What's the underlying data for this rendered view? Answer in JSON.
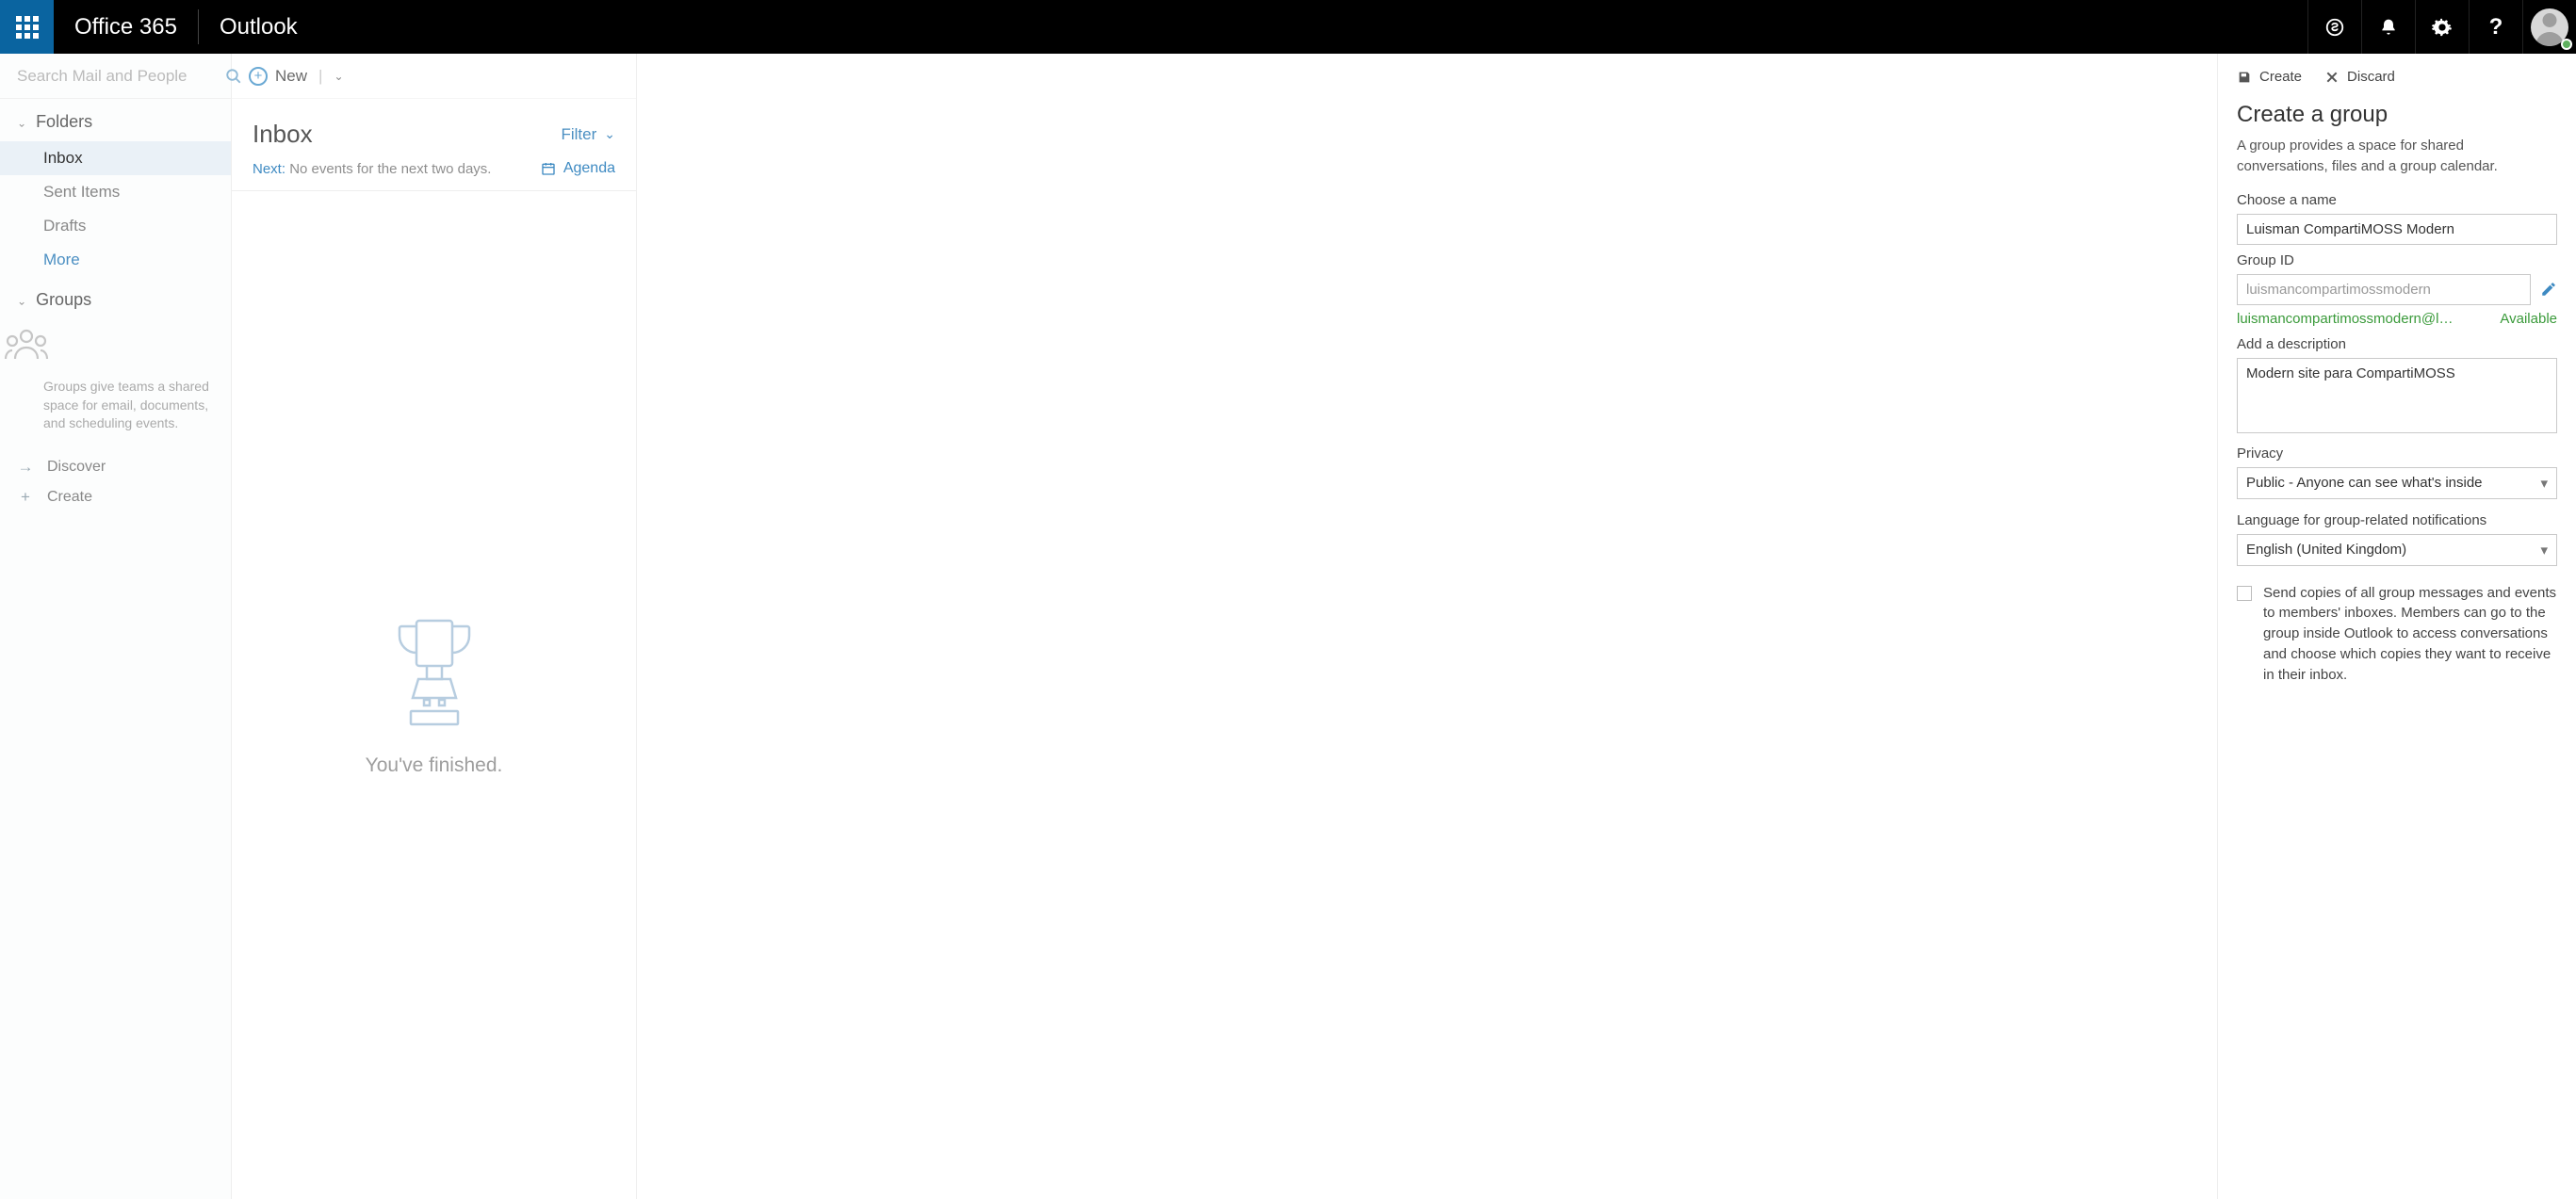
{
  "header": {
    "brand": "Office 365",
    "app": "Outlook"
  },
  "search": {
    "placeholder": "Search Mail and People"
  },
  "folders": {
    "section_label": "Folders",
    "items": [
      "Inbox",
      "Sent Items",
      "Drafts",
      "More"
    ],
    "active_index": 0,
    "more_index": 3
  },
  "groups": {
    "section_label": "Groups",
    "promo": "Groups give teams a shared space for email, documents, and scheduling events."
  },
  "sidebar_actions": {
    "discover": "Discover",
    "create": "Create"
  },
  "newbar": {
    "new_label": "New"
  },
  "list": {
    "folder_title": "Inbox",
    "filter_label": "Filter",
    "next_label": "Next:",
    "next_text": "No events for the next two days.",
    "agenda_label": "Agenda",
    "empty_text": "You've finished."
  },
  "panel": {
    "create_btn": "Create",
    "discard_btn": "Discard",
    "title": "Create a group",
    "description": "A group provides a space for shared conversations, files and a group calendar.",
    "name_label": "Choose a name",
    "name_value": "Luisman CompartiMOSS Modern",
    "id_label": "Group ID",
    "id_placeholder": "luismancompartimossmodern",
    "id_email": "luismancompartimossmodern@lman...",
    "id_status": "Available",
    "desc_label": "Add a description",
    "desc_value": "Modern site para CompartiMOSS",
    "privacy_label": "Privacy",
    "privacy_value": "Public - Anyone can see what's inside",
    "lang_label": "Language for group-related notifications",
    "lang_value": "English (United Kingdom)",
    "copies_label": "Send copies of all group messages and events to members' inboxes. Members can go to the group inside Outlook to access conversations and choose which copies they want to receive in their inbox."
  }
}
